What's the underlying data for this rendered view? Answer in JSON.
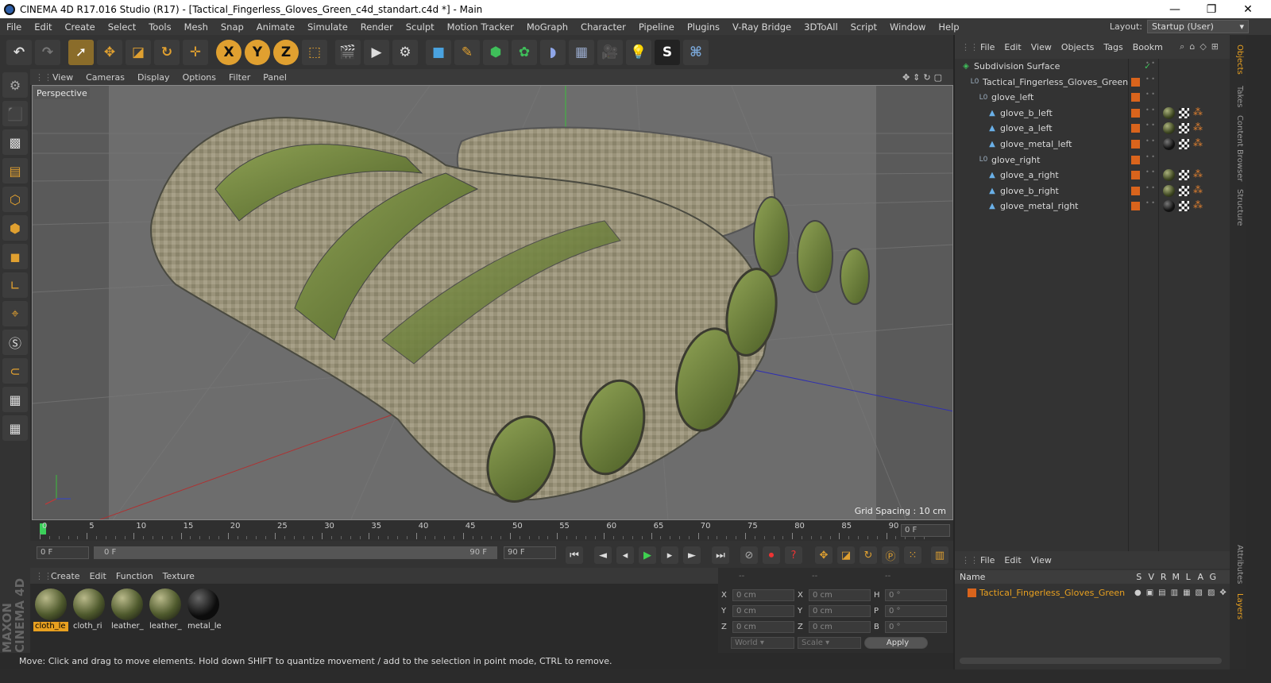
{
  "window": {
    "title": "CINEMA 4D R17.016 Studio (R17) - [Tactical_Fingerless_Gloves_Green_c4d_standart.c4d *] - Main",
    "minimize": "—",
    "maximize": "❐",
    "close": "✕"
  },
  "menubar": {
    "items": [
      "File",
      "Edit",
      "Create",
      "Select",
      "Tools",
      "Mesh",
      "Snap",
      "Animate",
      "Simulate",
      "Render",
      "Sculpt",
      "Motion Tracker",
      "MoGraph",
      "Character",
      "Pipeline",
      "Plugins",
      "V-Ray Bridge",
      "3DToAll",
      "Script",
      "Window",
      "Help"
    ],
    "layout_label": "Layout:",
    "layout_value": "Startup (User)"
  },
  "toolbar": {
    "icons": [
      "undo-icon",
      "redo-icon",
      "select-icon",
      "move-icon",
      "scale-icon",
      "rotate-icon",
      "live-select-icon",
      "x-axis-icon",
      "y-axis-icon",
      "z-axis-icon",
      "coord-system-icon",
      "render-view-icon",
      "render-picture-icon",
      "render-settings-icon",
      "cube-icon",
      "pen-icon",
      "subdivision-icon",
      "mograph-icon",
      "deformer-icon",
      "floor-icon",
      "camera-icon",
      "light-icon",
      "spline-icon",
      "python-icon"
    ]
  },
  "viewport": {
    "menu": [
      "View",
      "Cameras",
      "Display",
      "Options",
      "Filter",
      "Panel"
    ],
    "label": "Perspective",
    "grid_spacing": "Grid Spacing : 10 cm"
  },
  "timeline": {
    "ticks": [
      "0",
      "5",
      "10",
      "15",
      "20",
      "25",
      "30",
      "35",
      "40",
      "45",
      "50",
      "55",
      "60",
      "65",
      "70",
      "75",
      "80",
      "85",
      "90"
    ],
    "current": "0 F",
    "start": "0 F",
    "range_start": "0 F",
    "range_end": "90 F",
    "end": "90 F"
  },
  "materials": {
    "menu": [
      "Create",
      "Edit",
      "Function",
      "Texture"
    ],
    "items": [
      {
        "label": "cloth_le",
        "selected": true
      },
      {
        "label": "cloth_ri",
        "selected": false
      },
      {
        "label": "leather_",
        "selected": false
      },
      {
        "label": "leather_",
        "selected": false
      },
      {
        "label": "metal_le",
        "selected": false
      }
    ]
  },
  "coords": {
    "headers": [
      "--",
      "--",
      "--"
    ],
    "rows": [
      {
        "a": "X",
        "av": "0 cm",
        "b": "X",
        "bv": "0 cm",
        "c": "H",
        "cv": "0 °"
      },
      {
        "a": "Y",
        "av": "0 cm",
        "b": "Y",
        "bv": "0 cm",
        "c": "P",
        "cv": "0 °"
      },
      {
        "a": "Z",
        "av": "0 cm",
        "b": "Z",
        "bv": "0 cm",
        "c": "B",
        "cv": "0 °"
      }
    ],
    "mode": "World",
    "scale": "Scale",
    "apply": "Apply"
  },
  "objects": {
    "menu": [
      "File",
      "Edit",
      "View",
      "Objects",
      "Tags",
      "Bookm"
    ],
    "tree": [
      {
        "name": "Subdivision Surface",
        "depth": 0,
        "kind": "subdiv"
      },
      {
        "name": "Tactical_Fingerless_Gloves_Green",
        "depth": 1,
        "kind": "null"
      },
      {
        "name": "glove_left",
        "depth": 2,
        "kind": "null"
      },
      {
        "name": "glove_b_left",
        "depth": 3,
        "kind": "poly",
        "mat": "cloth"
      },
      {
        "name": "glove_a_left",
        "depth": 3,
        "kind": "poly",
        "mat": "cloth"
      },
      {
        "name": "glove_metal_left",
        "depth": 3,
        "kind": "poly",
        "mat": "metal"
      },
      {
        "name": "glove_right",
        "depth": 2,
        "kind": "null"
      },
      {
        "name": "glove_a_right",
        "depth": 3,
        "kind": "poly",
        "mat": "cloth"
      },
      {
        "name": "glove_b_right",
        "depth": 3,
        "kind": "poly",
        "mat": "cloth"
      },
      {
        "name": "glove_metal_right",
        "depth": 3,
        "kind": "poly",
        "mat": "metal"
      }
    ]
  },
  "layers": {
    "menu": [
      "File",
      "Edit",
      "View"
    ],
    "columns": [
      "Name",
      "S",
      "V",
      "R",
      "M",
      "L",
      "A",
      "G"
    ],
    "rows": [
      {
        "name": "Tactical_Fingerless_Gloves_Green",
        "color": "#d9641c"
      }
    ]
  },
  "right_tabs": [
    "Objects",
    "Takes",
    "Content Browser",
    "Structure",
    "Attributes",
    "Layers"
  ],
  "status": "Move: Click and drag to move elements. Hold down SHIFT to quantize movement / add to the selection in point mode, CTRL to remove.",
  "brand": "MAXON CINEMA 4D"
}
